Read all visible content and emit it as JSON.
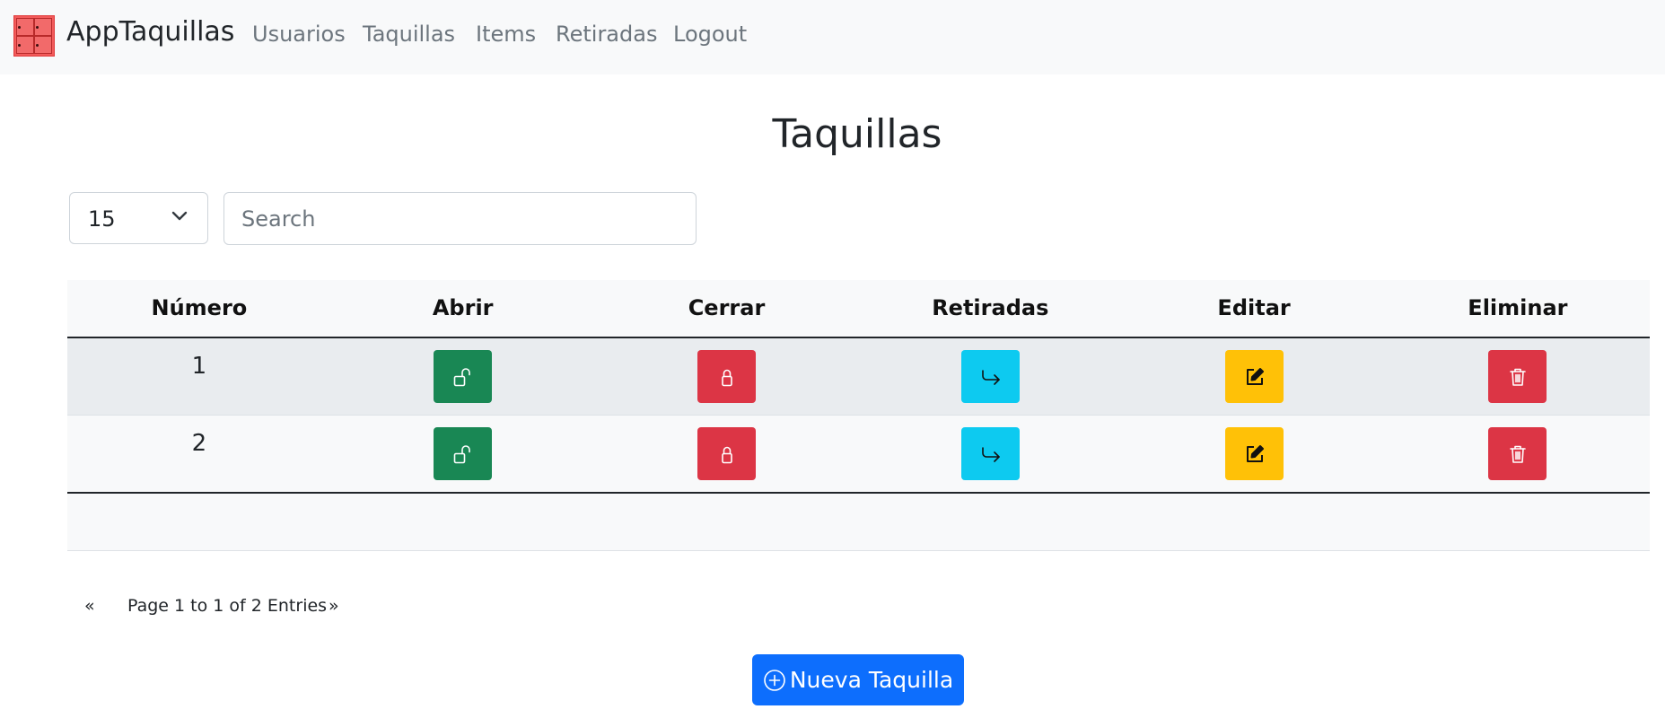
{
  "navbar": {
    "brand": "AppTaquillas",
    "logo_icon": "locker-logo-icon",
    "links": [
      "Usuarios",
      "Taquillas",
      "Items",
      "Retiradas",
      "Logout"
    ]
  },
  "page": {
    "title": "Taquillas"
  },
  "controls": {
    "page_size": "15",
    "search_placeholder": "Search",
    "search_value": ""
  },
  "table": {
    "columns": [
      "Número",
      "Abrir",
      "Cerrar",
      "Retiradas",
      "Editar",
      "Eliminar"
    ],
    "rows": [
      {
        "numero": "1"
      },
      {
        "numero": "2"
      }
    ],
    "actions": [
      {
        "name": "abrir",
        "icon": "unlock-icon",
        "color": "#198754"
      },
      {
        "name": "cerrar",
        "icon": "lock-icon",
        "color": "#dc3545"
      },
      {
        "name": "retiradas",
        "icon": "arrow-return-right-icon",
        "color": "#0dcaf0"
      },
      {
        "name": "editar",
        "icon": "pencil-square-icon",
        "color": "#ffc107"
      },
      {
        "name": "eliminar",
        "icon": "trash-icon",
        "color": "#dc3545"
      }
    ]
  },
  "pagination": {
    "prev": "«",
    "next": "»",
    "info": "Page 1 to 1 of 2 Entries"
  },
  "new_button": {
    "label": "Nueva Taquilla",
    "icon": "plus-circle-icon"
  },
  "colors": {
    "primary": "#0d6efd",
    "success": "#198754",
    "danger": "#dc3545",
    "info": "#0dcaf0",
    "warning": "#ffc107",
    "navbar_bg": "#f8f9fa"
  }
}
